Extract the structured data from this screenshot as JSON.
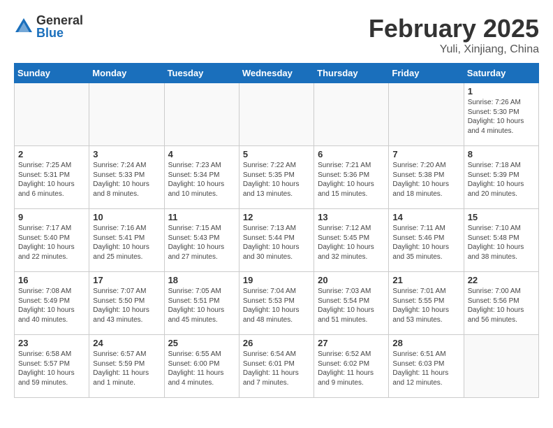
{
  "header": {
    "logo_general": "General",
    "logo_blue": "Blue",
    "month_title": "February 2025",
    "location": "Yuli, Xinjiang, China"
  },
  "days_of_week": [
    "Sunday",
    "Monday",
    "Tuesday",
    "Wednesday",
    "Thursday",
    "Friday",
    "Saturday"
  ],
  "weeks": [
    [
      {
        "day": "",
        "info": ""
      },
      {
        "day": "",
        "info": ""
      },
      {
        "day": "",
        "info": ""
      },
      {
        "day": "",
        "info": ""
      },
      {
        "day": "",
        "info": ""
      },
      {
        "day": "",
        "info": ""
      },
      {
        "day": "1",
        "info": "Sunrise: 7:26 AM\nSunset: 5:30 PM\nDaylight: 10 hours\nand 4 minutes."
      }
    ],
    [
      {
        "day": "2",
        "info": "Sunrise: 7:25 AM\nSunset: 5:31 PM\nDaylight: 10 hours\nand 6 minutes."
      },
      {
        "day": "3",
        "info": "Sunrise: 7:24 AM\nSunset: 5:33 PM\nDaylight: 10 hours\nand 8 minutes."
      },
      {
        "day": "4",
        "info": "Sunrise: 7:23 AM\nSunset: 5:34 PM\nDaylight: 10 hours\nand 10 minutes."
      },
      {
        "day": "5",
        "info": "Sunrise: 7:22 AM\nSunset: 5:35 PM\nDaylight: 10 hours\nand 13 minutes."
      },
      {
        "day": "6",
        "info": "Sunrise: 7:21 AM\nSunset: 5:36 PM\nDaylight: 10 hours\nand 15 minutes."
      },
      {
        "day": "7",
        "info": "Sunrise: 7:20 AM\nSunset: 5:38 PM\nDaylight: 10 hours\nand 18 minutes."
      },
      {
        "day": "8",
        "info": "Sunrise: 7:18 AM\nSunset: 5:39 PM\nDaylight: 10 hours\nand 20 minutes."
      }
    ],
    [
      {
        "day": "9",
        "info": "Sunrise: 7:17 AM\nSunset: 5:40 PM\nDaylight: 10 hours\nand 22 minutes."
      },
      {
        "day": "10",
        "info": "Sunrise: 7:16 AM\nSunset: 5:41 PM\nDaylight: 10 hours\nand 25 minutes."
      },
      {
        "day": "11",
        "info": "Sunrise: 7:15 AM\nSunset: 5:43 PM\nDaylight: 10 hours\nand 27 minutes."
      },
      {
        "day": "12",
        "info": "Sunrise: 7:13 AM\nSunset: 5:44 PM\nDaylight: 10 hours\nand 30 minutes."
      },
      {
        "day": "13",
        "info": "Sunrise: 7:12 AM\nSunset: 5:45 PM\nDaylight: 10 hours\nand 32 minutes."
      },
      {
        "day": "14",
        "info": "Sunrise: 7:11 AM\nSunset: 5:46 PM\nDaylight: 10 hours\nand 35 minutes."
      },
      {
        "day": "15",
        "info": "Sunrise: 7:10 AM\nSunset: 5:48 PM\nDaylight: 10 hours\nand 38 minutes."
      }
    ],
    [
      {
        "day": "16",
        "info": "Sunrise: 7:08 AM\nSunset: 5:49 PM\nDaylight: 10 hours\nand 40 minutes."
      },
      {
        "day": "17",
        "info": "Sunrise: 7:07 AM\nSunset: 5:50 PM\nDaylight: 10 hours\nand 43 minutes."
      },
      {
        "day": "18",
        "info": "Sunrise: 7:05 AM\nSunset: 5:51 PM\nDaylight: 10 hours\nand 45 minutes."
      },
      {
        "day": "19",
        "info": "Sunrise: 7:04 AM\nSunset: 5:53 PM\nDaylight: 10 hours\nand 48 minutes."
      },
      {
        "day": "20",
        "info": "Sunrise: 7:03 AM\nSunset: 5:54 PM\nDaylight: 10 hours\nand 51 minutes."
      },
      {
        "day": "21",
        "info": "Sunrise: 7:01 AM\nSunset: 5:55 PM\nDaylight: 10 hours\nand 53 minutes."
      },
      {
        "day": "22",
        "info": "Sunrise: 7:00 AM\nSunset: 5:56 PM\nDaylight: 10 hours\nand 56 minutes."
      }
    ],
    [
      {
        "day": "23",
        "info": "Sunrise: 6:58 AM\nSunset: 5:57 PM\nDaylight: 10 hours\nand 59 minutes."
      },
      {
        "day": "24",
        "info": "Sunrise: 6:57 AM\nSunset: 5:59 PM\nDaylight: 11 hours\nand 1 minute."
      },
      {
        "day": "25",
        "info": "Sunrise: 6:55 AM\nSunset: 6:00 PM\nDaylight: 11 hours\nand 4 minutes."
      },
      {
        "day": "26",
        "info": "Sunrise: 6:54 AM\nSunset: 6:01 PM\nDaylight: 11 hours\nand 7 minutes."
      },
      {
        "day": "27",
        "info": "Sunrise: 6:52 AM\nSunset: 6:02 PM\nDaylight: 11 hours\nand 9 minutes."
      },
      {
        "day": "28",
        "info": "Sunrise: 6:51 AM\nSunset: 6:03 PM\nDaylight: 11 hours\nand 12 minutes."
      },
      {
        "day": "",
        "info": ""
      }
    ]
  ]
}
